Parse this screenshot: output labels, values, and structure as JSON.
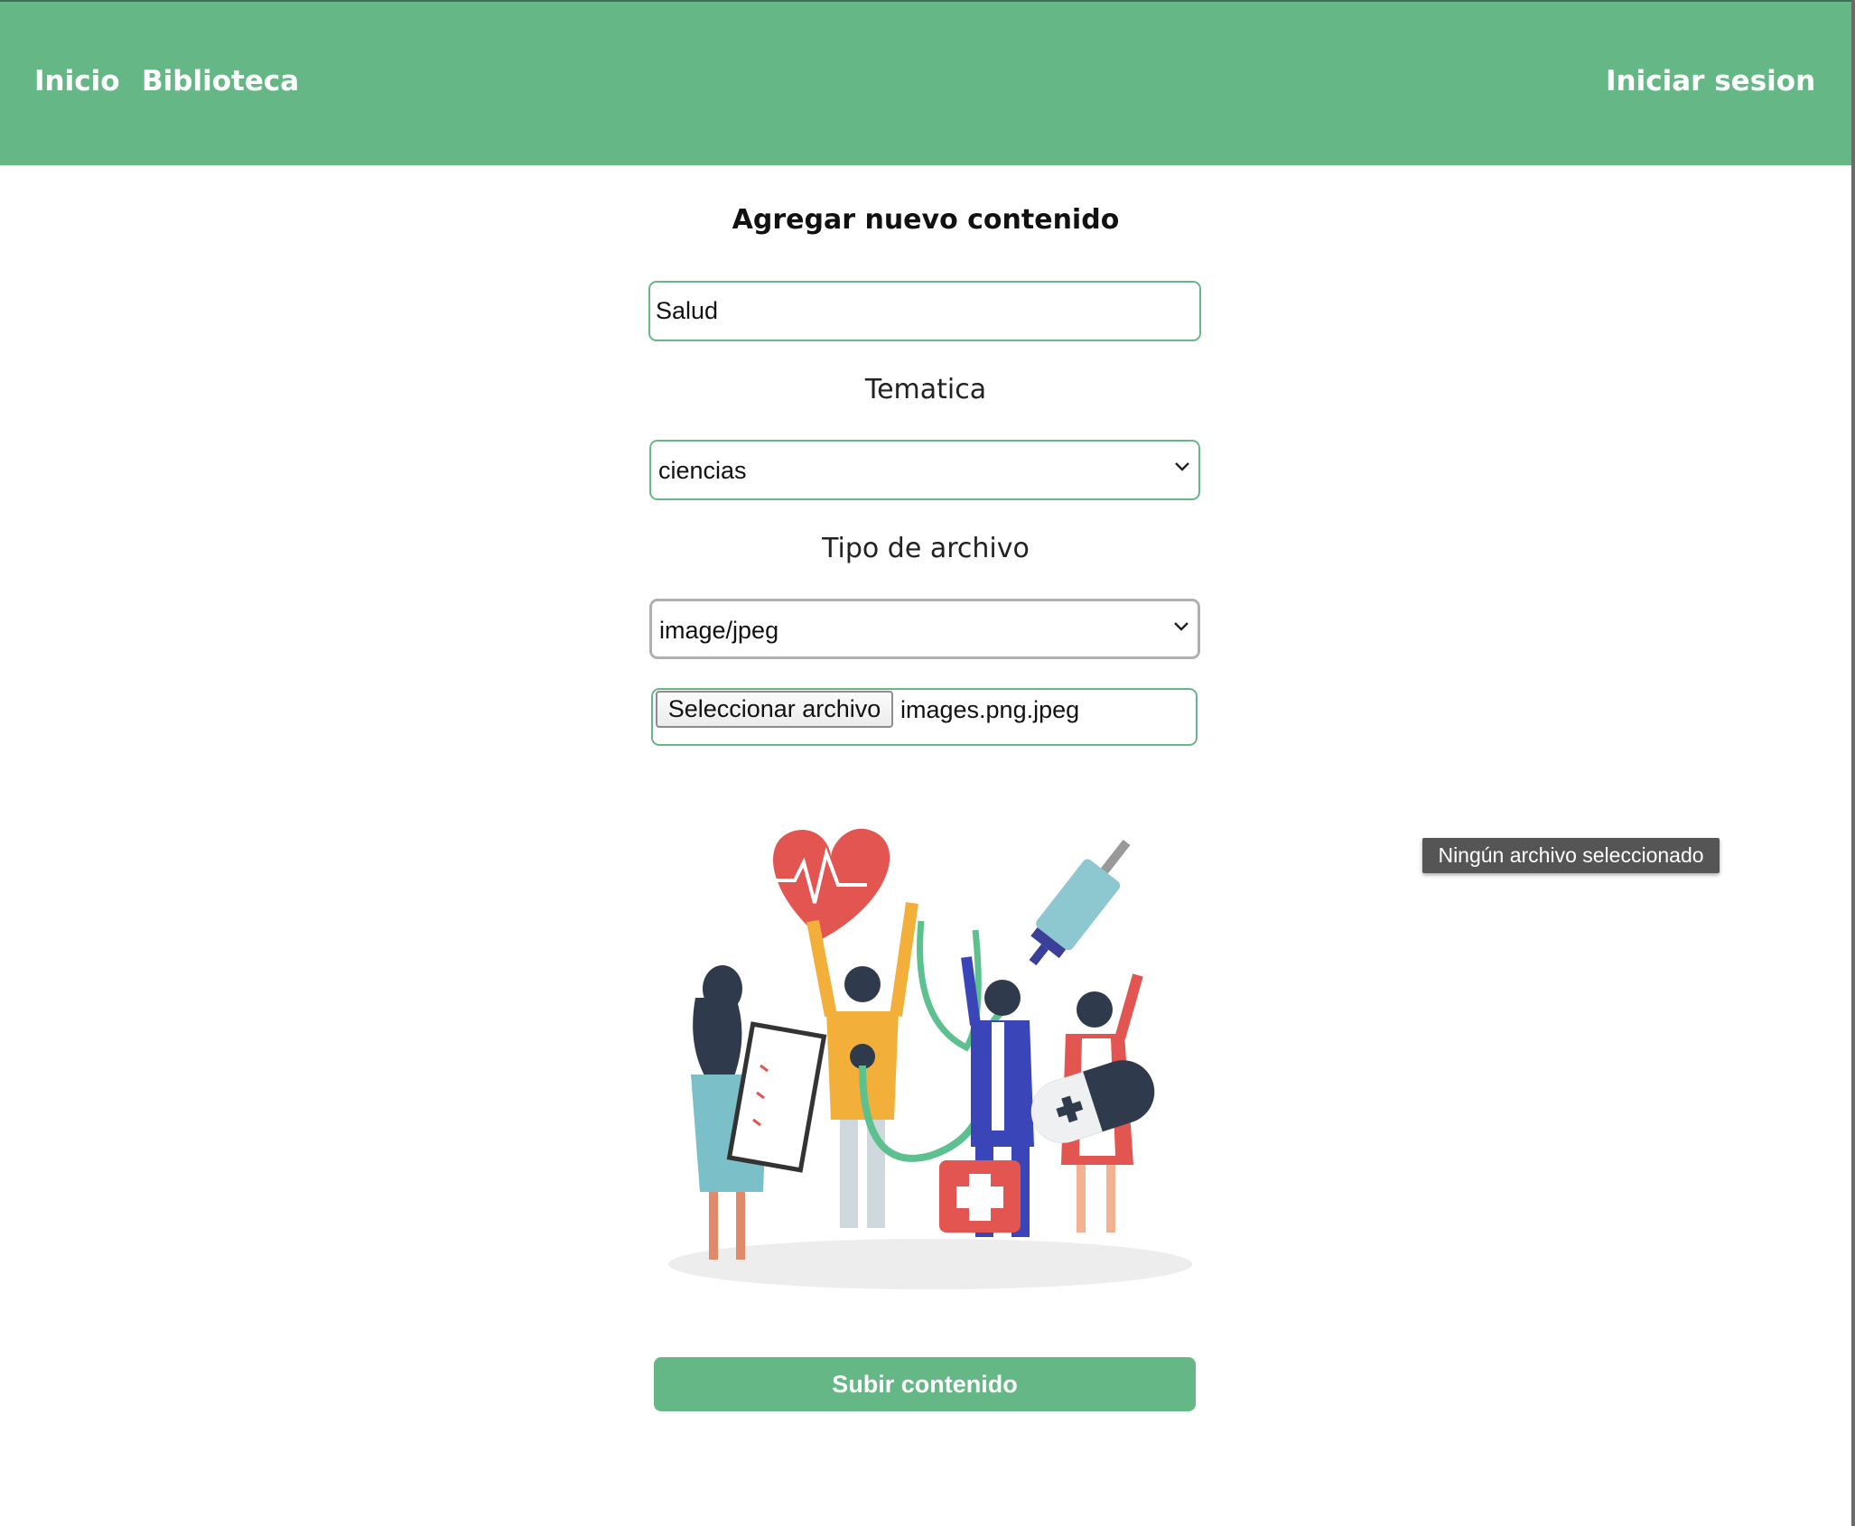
{
  "nav": {
    "inicio": "Inicio",
    "biblioteca": "Biblioteca",
    "login": "Iniciar sesion"
  },
  "form": {
    "heading": "Agregar nuevo contenido",
    "title_value": "Salud",
    "tematica_label": "Tematica",
    "tematica_selected": "ciencias",
    "tipo_label": "Tipo de archivo",
    "tipo_selected": "image/jpeg",
    "file_button": "Seleccionar archivo",
    "file_name": "images.png.jpeg",
    "submit_label": "Subir contenido"
  },
  "tooltip": {
    "text": "Ningún archivo seleccionado"
  },
  "preview": {
    "icon": "health-team-illustration"
  },
  "colors": {
    "accent": "#65b886",
    "tooltip_bg": "#555555"
  }
}
